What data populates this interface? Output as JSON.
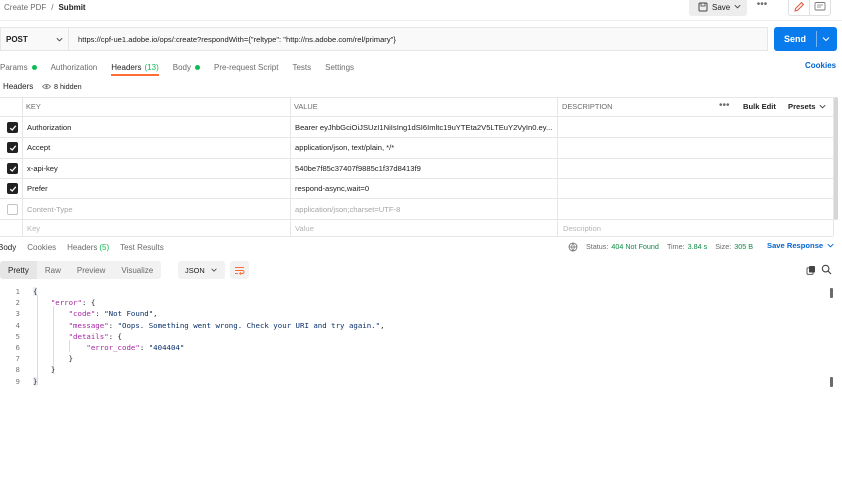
{
  "breadcrumb": {
    "parent": "Create PDF",
    "separator": "/",
    "current": "Submit"
  },
  "toolbar": {
    "save_label": "Save",
    "more": "•••"
  },
  "request": {
    "method": "POST",
    "url": "https://cpf-ue1.adobe.io/ops/:create?respondWith={\"reltype\": \"http://ns.adobe.com/rel/primary\"}",
    "send_label": "Send"
  },
  "request_tabs": [
    {
      "label": "Params",
      "dot": true
    },
    {
      "label": "Authorization"
    },
    {
      "label": "Headers",
      "count": "(13)",
      "active": true
    },
    {
      "label": "Body",
      "dot": true
    },
    {
      "label": "Pre-request Script"
    },
    {
      "label": "Tests"
    },
    {
      "label": "Settings"
    }
  ],
  "cookies_label": "Cookies",
  "headers_section": {
    "label": "Headers",
    "hidden": "8 hidden"
  },
  "table": {
    "columns": [
      "KEY",
      "VALUE",
      "DESCRIPTION"
    ],
    "bulk_edit": "Bulk Edit",
    "presets": "Presets",
    "rows": [
      {
        "checked": true,
        "key": "Authorization",
        "value": "Bearer eyJhbGciOiJSUzI1NiIsIng1dSI6Imltc19uYTEta2V5LTEuY2VyIn0.ey..."
      },
      {
        "checked": true,
        "key": "Accept",
        "value": "application/json, text/plain, */*"
      },
      {
        "checked": true,
        "key": "x-api-key",
        "value": "540be7f85c37407f9885c1f37d8413f9"
      },
      {
        "checked": true,
        "key": "Prefer",
        "value": "respond-async,wait=0"
      },
      {
        "checked": false,
        "key": "Content-Type",
        "value": "application/json;charset=UTF-8"
      }
    ],
    "placeholder": {
      "key": "Key",
      "value": "Value",
      "description": "Description"
    }
  },
  "response": {
    "tabs": [
      {
        "label": "Body",
        "active": true
      },
      {
        "label": "Cookies"
      },
      {
        "label": "Headers",
        "count": "(5)"
      },
      {
        "label": "Test Results"
      }
    ],
    "status_label": "Status:",
    "status_value": "404 Not Found",
    "time_label": "Time:",
    "time_value": "3.84 s",
    "size_label": "Size:",
    "size_value": "305 B",
    "save_response": "Save Response",
    "formats": [
      "Pretty",
      "Raw",
      "Preview",
      "Visualize"
    ],
    "language": "JSON"
  },
  "code_lines": [
    {
      "n": "1",
      "text": "{"
    },
    {
      "n": "2",
      "indent": "    ",
      "key": "\"error\"",
      "rest": ": {"
    },
    {
      "n": "3",
      "indent": "        ",
      "key": "\"code\"",
      "rest": ": ",
      "str": "\"Not Found\"",
      "tail": ","
    },
    {
      "n": "4",
      "indent": "        ",
      "key": "\"message\"",
      "rest": ": ",
      "str": "\"Oops. Something went wrong. Check your URI and try again.\"",
      "tail": ","
    },
    {
      "n": "5",
      "indent": "        ",
      "key": "\"details\"",
      "rest": ": {"
    },
    {
      "n": "6",
      "indent": "            ",
      "key": "\"error_code\"",
      "rest": ": ",
      "str": "\"404404\""
    },
    {
      "n": "7",
      "indent": "        ",
      "text": "}"
    },
    {
      "n": "8",
      "indent": "    ",
      "text": "}"
    },
    {
      "n": "9",
      "text": "}"
    }
  ],
  "colors": {
    "accent": "#ff6c37",
    "send": "#097bed",
    "link": "#0265d2",
    "ok_dot": "#0cbb52"
  }
}
